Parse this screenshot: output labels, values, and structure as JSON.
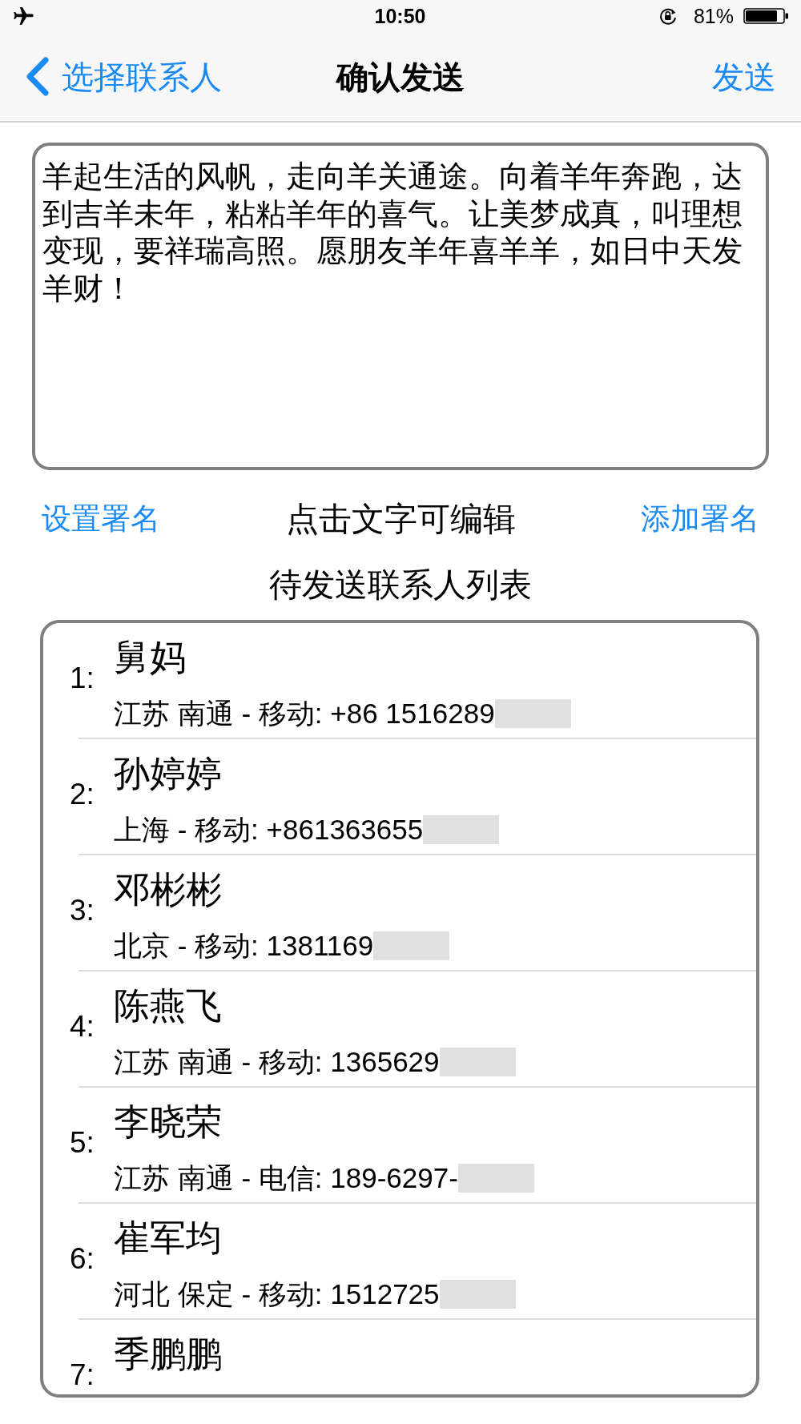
{
  "status_bar": {
    "airplane_mode": true,
    "time": "10:50",
    "rotation_lock": true,
    "battery": "81%"
  },
  "nav": {
    "back": "选择联系人",
    "title": "确认发送",
    "action": "发送"
  },
  "message": {
    "text": "羊起生活的风帆，走向羊关通途。向着羊年奔跑，达到吉羊未年，粘粘羊年的喜气。让美梦成真，叫理想变现，要祥瑞高照。愿朋友羊年喜羊羊，如日中天发羊财！"
  },
  "signature": {
    "set": "设置署名",
    "hint": "点击文字可编辑",
    "add": "添加署名"
  },
  "contacts_heading": "待发送联系人列表",
  "contacts": [
    {
      "index": "1:",
      "name": "舅妈",
      "detail": "江苏 南通 - 移动: +86 1516289",
      "redacted": true
    },
    {
      "index": "2:",
      "name": "孙婷婷",
      "detail": "上海 - 移动: +861363655",
      "redacted": true
    },
    {
      "index": "3:",
      "name": "邓彬彬",
      "detail": "北京 - 移动: 1381169",
      "redacted": true
    },
    {
      "index": "4:",
      "name": "陈燕飞",
      "detail": "江苏 南通 - 移动: 1365629",
      "redacted": true
    },
    {
      "index": "5:",
      "name": "李晓荣",
      "detail": "江苏 南通 - 电信: 189-6297-",
      "redacted": true
    },
    {
      "index": "6:",
      "name": "崔军均",
      "detail": "河北 保定 - 移动: 1512725",
      "redacted": true
    },
    {
      "index": "7:",
      "name": "季鹏鹏"
    }
  ]
}
